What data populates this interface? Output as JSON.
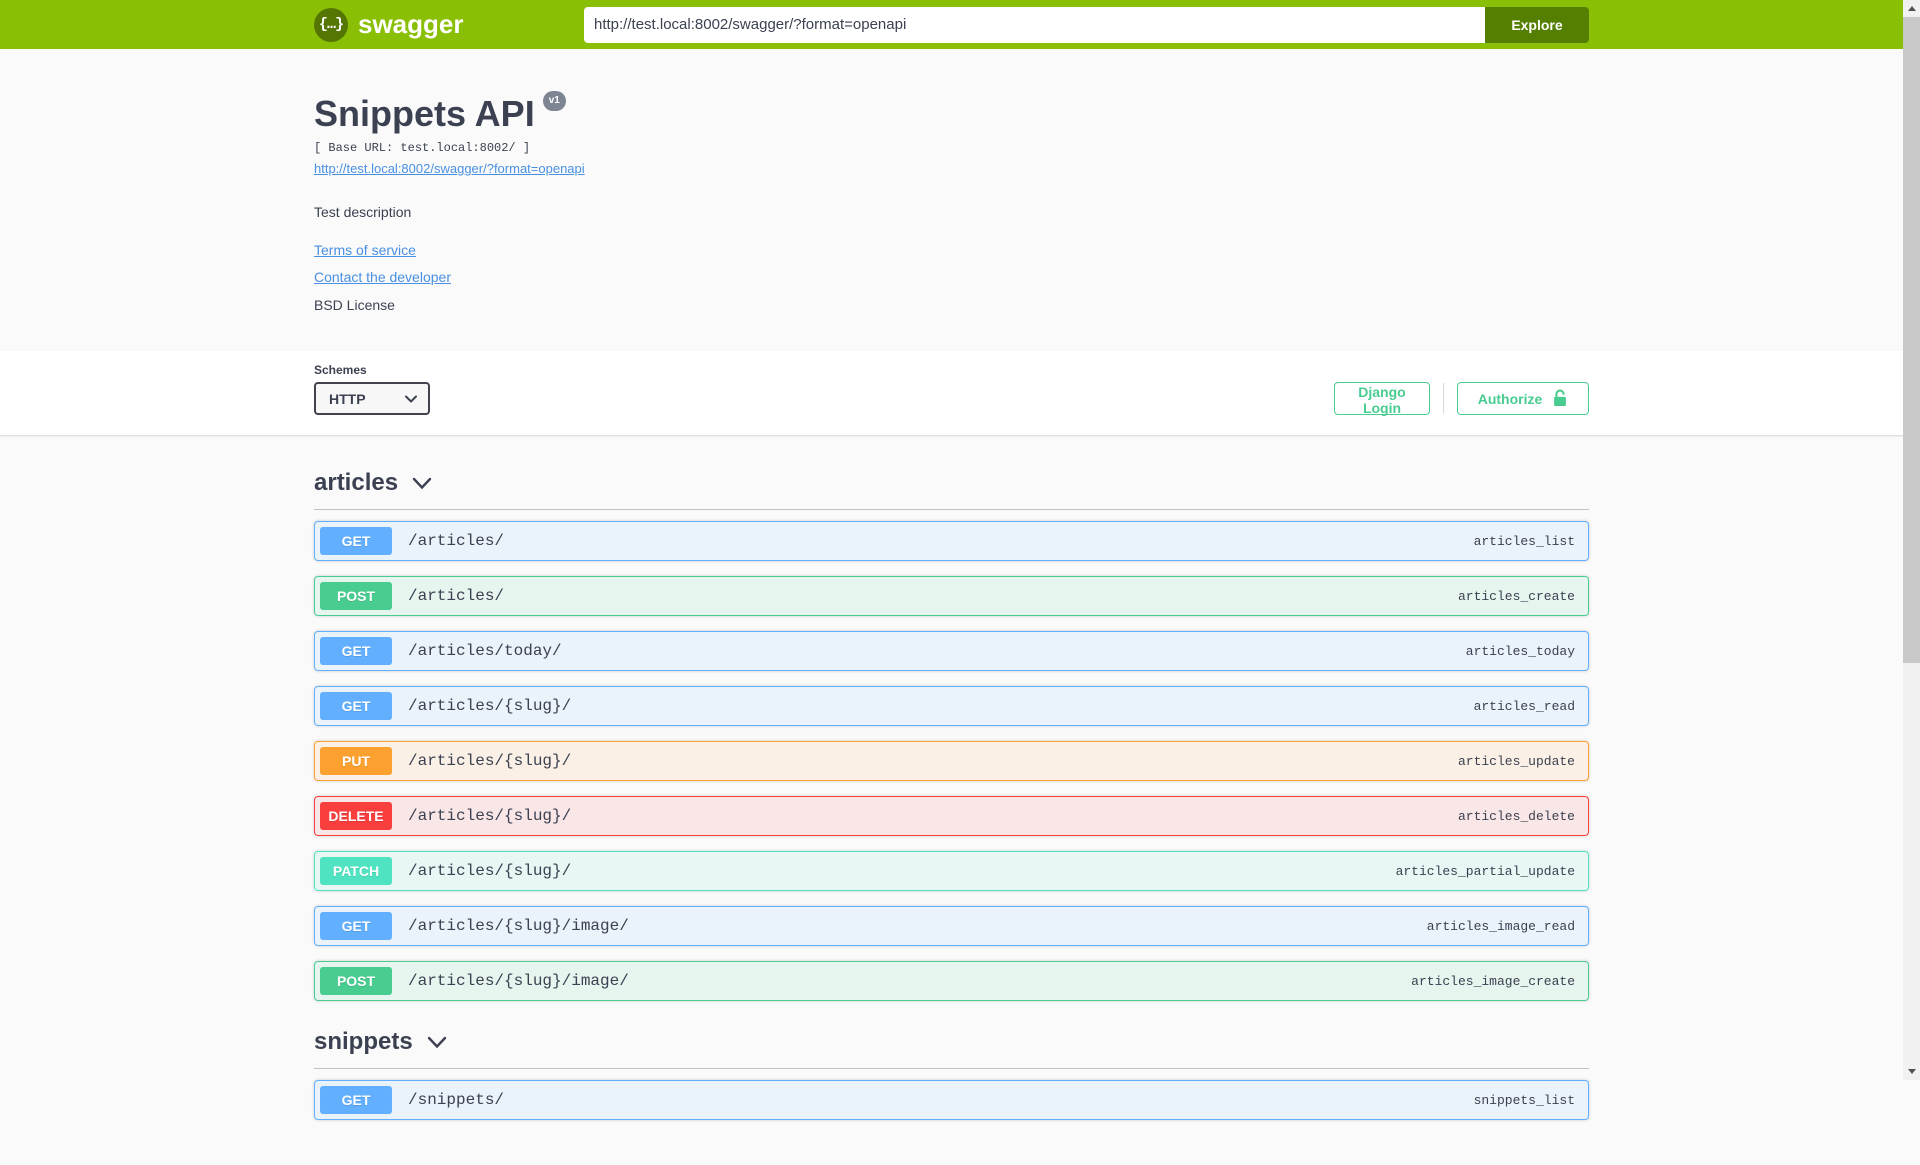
{
  "topbar": {
    "logo_text": "swagger",
    "logo_icon_glyph": "{…}",
    "url_value": "http://test.local:8002/swagger/?format=openapi",
    "explore_label": "Explore"
  },
  "info": {
    "title": "Snippets API",
    "version_badge": "v1",
    "base_url": "[ Base URL: test.local:8002/ ]",
    "spec_link": "http://test.local:8002/swagger/?format=openapi",
    "description": "Test description",
    "terms_link": "Terms of service",
    "contact_link": "Contact the developer",
    "license_text": "BSD License"
  },
  "scheme_bar": {
    "schemes_label": "Schemes",
    "selected_scheme": "HTTP",
    "django_login_label": "Django Login",
    "authorize_label": "Authorize"
  },
  "colors": {
    "topbar": "#89bf04",
    "explore_button": "#547f00",
    "accent_green": "#49cc90",
    "heading_text": "#3b4151",
    "link_blue": "#4990e2",
    "methods": {
      "GET": "#61affe",
      "POST": "#49cc90",
      "PUT": "#fca130",
      "DELETE": "#f93e3e",
      "PATCH": "#50e3c2"
    }
  },
  "sections": [
    {
      "name": "articles",
      "operations": [
        {
          "method": "GET",
          "path": "/articles/",
          "operation_id": "articles_list"
        },
        {
          "method": "POST",
          "path": "/articles/",
          "operation_id": "articles_create"
        },
        {
          "method": "GET",
          "path": "/articles/today/",
          "operation_id": "articles_today"
        },
        {
          "method": "GET",
          "path": "/articles/{slug}/",
          "operation_id": "articles_read"
        },
        {
          "method": "PUT",
          "path": "/articles/{slug}/",
          "operation_id": "articles_update"
        },
        {
          "method": "DELETE",
          "path": "/articles/{slug}/",
          "operation_id": "articles_delete"
        },
        {
          "method": "PATCH",
          "path": "/articles/{slug}/",
          "operation_id": "articles_partial_update"
        },
        {
          "method": "GET",
          "path": "/articles/{slug}/image/",
          "operation_id": "articles_image_read"
        },
        {
          "method": "POST",
          "path": "/articles/{slug}/image/",
          "operation_id": "articles_image_create"
        }
      ]
    },
    {
      "name": "snippets",
      "operations": [
        {
          "method": "GET",
          "path": "/snippets/",
          "operation_id": "snippets_list"
        }
      ]
    }
  ]
}
